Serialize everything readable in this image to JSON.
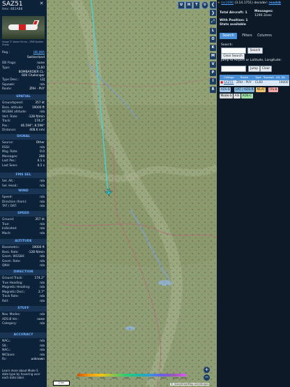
{
  "aircraft": {
    "callsign": "SAZ51",
    "hex_label": "Hex: 4B1A88",
    "photo_credit": "Image © Varani Enrico - VRM Spotter Group"
  },
  "details": {
    "reg": {
      "k": "Reg.:",
      "v": "HB-JWA"
    },
    "country": {
      "k": "",
      "v": "Switzerland"
    },
    "db_flags": {
      "k": "DB Flags:",
      "v": "none"
    },
    "type": {
      "k": "Type:",
      "v": "CL60"
    },
    "type_long": {
      "k": "",
      "v": "BOMBARDIER CL-600 Challenger"
    },
    "type_desc": {
      "k": "Type Desc.:",
      "v": "L2J"
    },
    "squawk": {
      "k": "Squawk:",
      "v": "n/a"
    },
    "route": {
      "k": "Route:",
      "v": "ZRH - PUY"
    }
  },
  "sections": {
    "spatial": {
      "title": "SPATIAL",
      "rows": [
        {
          "k": "Groundspeed:",
          "v": "357 kt"
        },
        {
          "k": "Baro. altitude:",
          "v": "19000 ft"
        },
        {
          "k": "WGS84 altitude:",
          "v": "n/a"
        },
        {
          "k": "Vert. Rate:",
          "v": "-128 ft/min"
        },
        {
          "k": "Track:",
          "v": "174.2°"
        },
        {
          "k": "Pos.:",
          "v": "46.594°, 8.598°"
        },
        {
          "k": "Distance:",
          "v": "408.6 nmi"
        }
      ]
    },
    "signal": {
      "title": "SIGNAL",
      "rows": [
        {
          "k": "Source:",
          "v": "Other"
        },
        {
          "k": "RSSI:",
          "v": "n/a"
        },
        {
          "k": "Msg. Rate:",
          "v": "0.0"
        },
        {
          "k": "Messages:",
          "v": "368"
        },
        {
          "k": "Last Pos.:",
          "v": "4.1 s"
        },
        {
          "k": "Last Seen:",
          "v": "4.1 s"
        }
      ]
    },
    "fms": {
      "title": "FMS SEL",
      "rows": [
        {
          "k": "Sel. Alt.:",
          "v": "n/a"
        },
        {
          "k": "Sel. Head.:",
          "v": "n/a"
        }
      ]
    },
    "wind": {
      "title": "WIND",
      "rows": [
        {
          "k": "Speed:",
          "v": "n/a"
        },
        {
          "k": "Direction (from):",
          "v": "n/a"
        },
        {
          "k": "TAT / OAT:",
          "v": "n/a"
        }
      ]
    },
    "speed": {
      "title": "SPEED",
      "rows": [
        {
          "k": "Ground:",
          "v": "357 kt"
        },
        {
          "k": "True:",
          "v": "n/a"
        },
        {
          "k": "Indicated:",
          "v": "n/a"
        },
        {
          "k": "Mach:",
          "v": "n/a"
        }
      ]
    },
    "altitude": {
      "title": "ALTITUDE",
      "rows": [
        {
          "k": "Barometric:",
          "v": "19000 ft"
        },
        {
          "k": "Baro. Rate:",
          "v": "-128 ft/min"
        },
        {
          "k": "Geom. WGS84:",
          "v": "n/a"
        },
        {
          "k": "Geom. Rate:",
          "v": "n/a"
        },
        {
          "k": "QNH:",
          "v": "n/a"
        }
      ]
    },
    "direction": {
      "title": "DIRECTION",
      "rows": [
        {
          "k": "Ground Track:",
          "v": "174.2°"
        },
        {
          "k": "True Heading:",
          "v": "n/a"
        },
        {
          "k": "Magnetic Heading:",
          "v": "n/a"
        },
        {
          "k": "Magnetic Decl.:",
          "v": "2.7°"
        },
        {
          "k": "Track Rate:",
          "v": "n/a"
        },
        {
          "k": "Roll:",
          "v": "n/a"
        }
      ]
    },
    "stuff": {
      "title": "STUFF",
      "rows": [
        {
          "k": "Nav. Modes:",
          "v": "n/a"
        },
        {
          "k": "ADS-B Ver.:",
          "v": "none"
        },
        {
          "k": "Category:",
          "v": "n/a"
        }
      ]
    },
    "accuracy": {
      "title": "ACCURACY",
      "rows": [
        {
          "k": "NACₚ:",
          "v": "n/a"
        },
        {
          "k": "SIL:",
          "v": "n/a"
        },
        {
          "k": "NACᵥ:",
          "v": "n/a"
        },
        {
          "k": "NICbaro:",
          "v": "n/a"
        },
        {
          "k": "Rc:",
          "v": "unknown"
        }
      ]
    }
  },
  "more_info": "Learn more about Mode S data type by hovering over each data label.",
  "map": {
    "buttons_top": [
      "U",
      "H",
      "T"
    ],
    "buttons_side": [
      "L",
      "O",
      "K",
      "M",
      "V",
      "P",
      "I",
      "R"
    ],
    "zoom_in": "+",
    "zoom_out": "−",
    "scale": "2 km",
    "alt_ticks": [
      "500",
      "1000",
      "2000",
      "4000",
      "6000",
      "8000",
      "10000",
      "20000",
      "30000",
      "40000+"
    ],
    "attribution": "© OpenStreetMap contributors"
  },
  "right": {
    "app_name": "tar1090",
    "version": "(3.14.1751)",
    "decoder_label": "decoder:",
    "decoder": "readsb",
    "total_aircraft_label": "Total Aircraft: 1",
    "messages_label": "Messages:",
    "messages_rate": "1290.3/sec",
    "with_position": "With Position: 1",
    "stats": "Stats available",
    "tabs": [
      "Search",
      "Filters",
      "Columns"
    ],
    "search_label": "Search:",
    "search_button": "Search",
    "clear_search": "Clear Search",
    "jump_label": "Jump to Airport or Latitude, Longitude:",
    "jump_button": "Jump",
    "clear_button": "Clear",
    "columns": [
      "Callsign",
      "Route",
      "Type",
      "Squawk",
      "Alt. (ft)"
    ],
    "row": {
      "callsign": "SAZ51",
      "route": "ZRH - PUY",
      "type": "CL60",
      "alt": "19000"
    },
    "badges": [
      "ADS-B",
      "UAT / ADS-R",
      "MLAT",
      "TIS-B",
      "Mode-S",
      "AIS",
      "ADS-C"
    ],
    "colors": {
      "adsb": "#9fc5e8",
      "uat": "#7fb2d6",
      "mlat": "#f6c26b",
      "tisb": "#f4a6a6",
      "modes": "#d9d9d9",
      "ais": "#e6e6e6",
      "adsc": "#9fe0a6"
    }
  }
}
